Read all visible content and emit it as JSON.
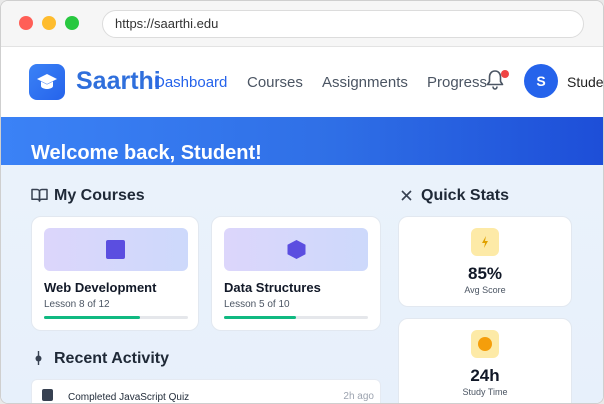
{
  "browser": {
    "url": "https://saarthi.edu"
  },
  "header": {
    "brand": "Saarthi",
    "nav": [
      "Dashboard",
      "Courses",
      "Assignments",
      "Progress"
    ],
    "active_nav": "Dashboard",
    "avatar_initial": "S",
    "user_name": "Student",
    "has_notification": true
  },
  "banner": {
    "welcome": "Welcome back, Student!"
  },
  "courses": {
    "title": "My Courses",
    "items": [
      {
        "name": "Web Development",
        "lesson": "Lesson 8 of 12",
        "progress": 0.67,
        "icon": "square-icon"
      },
      {
        "name": "Data Structures",
        "lesson": "Lesson 5 of 10",
        "progress": 0.5,
        "icon": "hexagon-icon"
      }
    ]
  },
  "stats": {
    "title": "Quick Stats",
    "items": [
      {
        "value": "85%",
        "label": "Avg Score",
        "icon": "lightning-icon"
      },
      {
        "value": "24h",
        "label": "Study Time",
        "icon": "clock-icon"
      }
    ]
  },
  "activity": {
    "title": "Recent Activity",
    "items": [
      {
        "text": "Completed JavaScript Quiz",
        "time": "2h ago",
        "icon": "document-icon"
      }
    ]
  },
  "colors": {
    "accent": "#2563eb",
    "progress": "#10b981",
    "banner": "#3b82f6"
  }
}
